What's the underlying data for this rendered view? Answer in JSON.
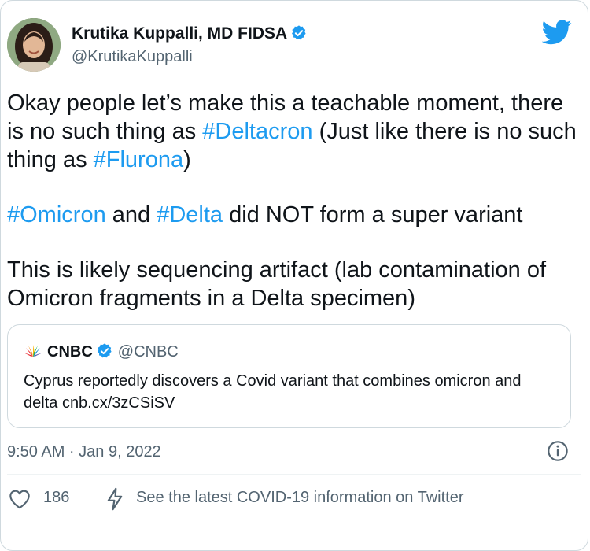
{
  "author": {
    "name": "Krutika Kuppalli, MD FIDSA",
    "handle": "@KrutikaKuppalli",
    "verified": true
  },
  "tweet": {
    "para1": {
      "t1": "Okay people let’s make this a teachable moment, there is no such thing as ",
      "tag1": "#Deltacron",
      "t2": " (Just like there is no such thing as ",
      "tag2": "#Flurona",
      "t3": ")"
    },
    "para2": {
      "tag1": "#Omicron",
      "t1": " and ",
      "tag2": "#Delta",
      "t2": " did NOT form a super variant"
    },
    "para3": "This is likely sequencing artifact (lab contamination of Omicron fragments in a Delta specimen)"
  },
  "quote": {
    "name": "CNBC",
    "handle": "@CNBC",
    "text": "Cyprus reportedly discovers a Covid variant that combines omicron and delta ",
    "link": "cnb.cx/3zCSiSV"
  },
  "timestamp": "9:50 AM · Jan 9, 2022",
  "actions": {
    "likes": "186",
    "covid_info": "See the latest COVID-19 information on Twitter"
  },
  "colors": {
    "accent": "#1d9bf0",
    "text": "#0f1419",
    "secondary": "#536471",
    "border": "#cfd9de"
  }
}
